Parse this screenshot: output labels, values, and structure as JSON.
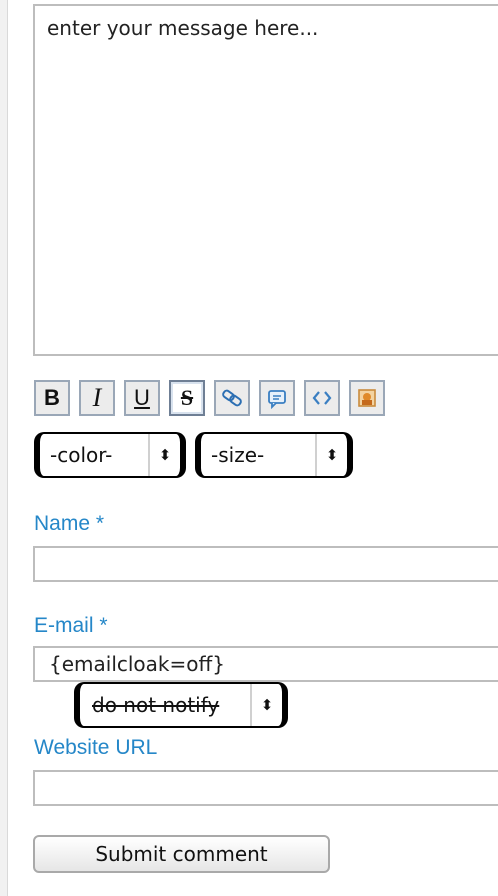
{
  "message": {
    "placeholder": "enter your message here..."
  },
  "toolbar": [
    {
      "name": "bold-button",
      "label": "B"
    },
    {
      "name": "italic-button",
      "label": "I"
    },
    {
      "name": "underline-button",
      "label": "U"
    },
    {
      "name": "strikethrough-button",
      "label": "S"
    },
    {
      "name": "link-button",
      "icon": "link-icon"
    },
    {
      "name": "quote-button",
      "icon": "quote-icon"
    },
    {
      "name": "code-button",
      "icon": "code-icon"
    },
    {
      "name": "image-button",
      "icon": "image-icon"
    }
  ],
  "formatting": {
    "color": "-color-",
    "size": "-size-"
  },
  "fields": {
    "name_label": "Name *",
    "name_value": "",
    "email_label": "E-mail *",
    "email_value": "{emailcloak=off}",
    "notify_value": "do not notify",
    "website_label": "Website URL",
    "website_value": ""
  },
  "submit_label": "Submit comment"
}
